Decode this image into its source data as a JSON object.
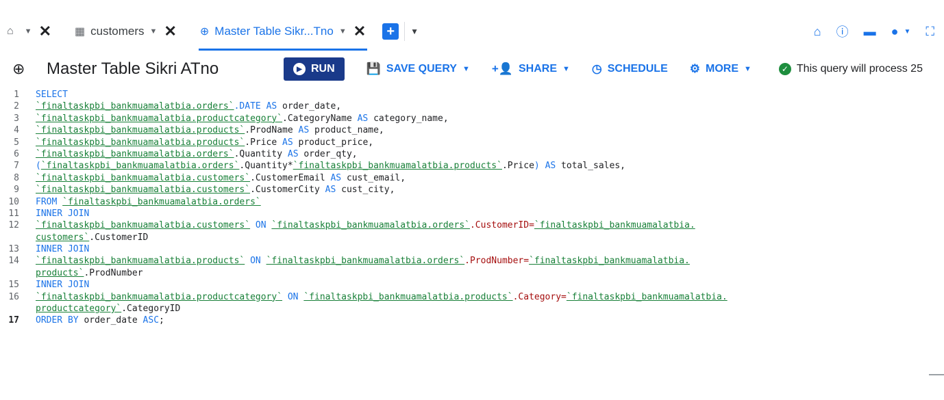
{
  "tabs": [
    {
      "icon": "⌂",
      "label": "",
      "dropdown": "▼",
      "close": "✕",
      "active": false,
      "name": "home"
    },
    {
      "icon": "▦",
      "label": "customers",
      "dropdown": "▼",
      "close": "✕",
      "active": false,
      "name": "customers"
    },
    {
      "icon": "⊕",
      "label": "Master Table Sikr...Tno",
      "dropdown": "▼",
      "close": "✕",
      "active": true,
      "name": "master-table"
    }
  ],
  "new_tab": {
    "plus": "+",
    "dropdown": "▼"
  },
  "header_icons": {
    "home": "⌂",
    "info": "ⓘ",
    "keyboard": "▬",
    "bulb": "●",
    "bulb_dd": "▼",
    "fullscreen": "⛶"
  },
  "query": {
    "icon": "⊕",
    "title": "Master Table Sikri ATno",
    "run_label": "RUN",
    "run_icon": "▶",
    "save_label": "SAVE QUERY",
    "save_icon": "💾",
    "share_label": "SHARE",
    "share_icon": "+👤",
    "schedule_label": "SCHEDULE",
    "schedule_icon": "◷",
    "more_label": "MORE",
    "more_icon": "⚙",
    "dropdown": "▼",
    "status_check": "✓",
    "status_text": "This query will process 25"
  },
  "colors": {
    "accent": "#1a73e8",
    "run": "#1a3a8a",
    "keyword": "#1a73e8",
    "table": "#188038",
    "field": "#a50e0e",
    "success": "#1e8e3e"
  },
  "editor": {
    "lines": [
      {
        "n": "1",
        "bold": false,
        "tokens": [
          {
            "t": "SELECT",
            "c": "kw"
          }
        ]
      },
      {
        "n": "2",
        "bold": false,
        "tokens": [
          {
            "t": "`finaltaskpbi_bankmuamalatbia.orders`",
            "c": "tb"
          },
          {
            "t": ".DATE ",
            "c": "kw"
          },
          {
            "t": "AS",
            "c": "kw"
          },
          {
            "t": " order_date,",
            "c": ""
          }
        ]
      },
      {
        "n": "3",
        "bold": false,
        "tokens": [
          {
            "t": "`finaltaskpbi_bankmuamalatbia.productcategory`",
            "c": "tb"
          },
          {
            "t": ".CategoryName ",
            "c": ""
          },
          {
            "t": "AS",
            "c": "kw"
          },
          {
            "t": " category_name,",
            "c": ""
          }
        ]
      },
      {
        "n": "4",
        "bold": false,
        "tokens": [
          {
            "t": "`finaltaskpbi_bankmuamalatbia.products`",
            "c": "tb"
          },
          {
            "t": ".ProdName ",
            "c": ""
          },
          {
            "t": "AS",
            "c": "kw"
          },
          {
            "t": " product_name,",
            "c": ""
          }
        ]
      },
      {
        "n": "5",
        "bold": false,
        "tokens": [
          {
            "t": "`finaltaskpbi_bankmuamalatbia.products`",
            "c": "tb"
          },
          {
            "t": ".Price ",
            "c": ""
          },
          {
            "t": "AS",
            "c": "kw"
          },
          {
            "t": " product_price,",
            "c": ""
          }
        ]
      },
      {
        "n": "6",
        "bold": false,
        "tokens": [
          {
            "t": "`finaltaskpbi_bankmuamalatbia.orders`",
            "c": "tb"
          },
          {
            "t": ".Quantity ",
            "c": ""
          },
          {
            "t": "AS",
            "c": "kw"
          },
          {
            "t": " order_qty,",
            "c": ""
          }
        ]
      },
      {
        "n": "7",
        "bold": false,
        "tokens": [
          {
            "t": "(",
            "c": "kw"
          },
          {
            "t": "`finaltaskpbi_bankmuamalatbia.orders`",
            "c": "tb"
          },
          {
            "t": ".Quantity*",
            "c": ""
          },
          {
            "t": "`finaltaskpbi_bankmuamalatbia.products`",
            "c": "tb"
          },
          {
            "t": ".Price",
            "c": ""
          },
          {
            "t": ")",
            "c": "kw"
          },
          {
            "t": " ",
            "c": ""
          },
          {
            "t": "AS",
            "c": "kw"
          },
          {
            "t": " total_sales,",
            "c": ""
          }
        ]
      },
      {
        "n": "8",
        "bold": false,
        "tokens": [
          {
            "t": "`finaltaskpbi_bankmuamalatbia.customers`",
            "c": "tb"
          },
          {
            "t": ".CustomerEmail ",
            "c": ""
          },
          {
            "t": "AS",
            "c": "kw"
          },
          {
            "t": " cust_email,",
            "c": ""
          }
        ]
      },
      {
        "n": "9",
        "bold": false,
        "tokens": [
          {
            "t": "`finaltaskpbi_bankmuamalatbia.customers`",
            "c": "tb"
          },
          {
            "t": ".CustomerCity ",
            "c": ""
          },
          {
            "t": "AS",
            "c": "kw"
          },
          {
            "t": " cust_city,",
            "c": ""
          }
        ]
      },
      {
        "n": "10",
        "bold": false,
        "tokens": [
          {
            "t": "FROM",
            "c": "kw"
          },
          {
            "t": " ",
            "c": ""
          },
          {
            "t": "`finaltaskpbi_bankmuamalatbia.orders`",
            "c": "tb"
          }
        ]
      },
      {
        "n": "11",
        "bold": false,
        "tokens": [
          {
            "t": "INNER JOIN",
            "c": "kw"
          }
        ]
      },
      {
        "n": "12",
        "bold": false,
        "tokens": [
          {
            "t": "`finaltaskpbi_bankmuamalatbia.customers`",
            "c": "tb"
          },
          {
            "t": " ON ",
            "c": "kw"
          },
          {
            "t": "`finaltaskpbi_bankmuamalatbia.orders`",
            "c": "tb"
          },
          {
            "t": ".CustomerID=",
            "c": "fld"
          },
          {
            "t": "`finaltaskpbi_bankmuamalatbia.",
            "c": "tb"
          }
        ]
      },
      {
        "n": "",
        "bold": false,
        "tokens": [
          {
            "t": "customers`",
            "c": "tb"
          },
          {
            "t": ".CustomerID",
            "c": ""
          }
        ]
      },
      {
        "n": "13",
        "bold": false,
        "tokens": [
          {
            "t": "INNER JOIN",
            "c": "kw"
          }
        ]
      },
      {
        "n": "14",
        "bold": false,
        "tokens": [
          {
            "t": "`finaltaskpbi_bankmuamalatbia.products`",
            "c": "tb"
          },
          {
            "t": " ON ",
            "c": "kw"
          },
          {
            "t": "`finaltaskpbi_bankmuamalatbia.orders`",
            "c": "tb"
          },
          {
            "t": ".ProdNumber=",
            "c": "fld"
          },
          {
            "t": "`finaltaskpbi_bankmuamalatbia.",
            "c": "tb"
          }
        ]
      },
      {
        "n": "",
        "bold": false,
        "tokens": [
          {
            "t": "products`",
            "c": "tb"
          },
          {
            "t": ".ProdNumber",
            "c": ""
          }
        ]
      },
      {
        "n": "15",
        "bold": false,
        "tokens": [
          {
            "t": "INNER JOIN",
            "c": "kw"
          }
        ]
      },
      {
        "n": "16",
        "bold": false,
        "tokens": [
          {
            "t": "`finaltaskpbi_bankmuamalatbia.productcategory`",
            "c": "tb"
          },
          {
            "t": " ON ",
            "c": "kw"
          },
          {
            "t": "`finaltaskpbi_bankmuamalatbia.products`",
            "c": "tb"
          },
          {
            "t": ".Category=",
            "c": "fld"
          },
          {
            "t": "`finaltaskpbi_bankmuamalatbia.",
            "c": "tb"
          }
        ]
      },
      {
        "n": "",
        "bold": false,
        "tokens": [
          {
            "t": "productcategory`",
            "c": "tb"
          },
          {
            "t": ".CategoryID",
            "c": ""
          }
        ]
      },
      {
        "n": "17",
        "bold": true,
        "tokens": [
          {
            "t": "ORDER BY",
            "c": "kw"
          },
          {
            "t": " order_date ",
            "c": ""
          },
          {
            "t": "ASC",
            "c": "kw"
          },
          {
            "t": ";",
            "c": ""
          }
        ]
      }
    ]
  }
}
